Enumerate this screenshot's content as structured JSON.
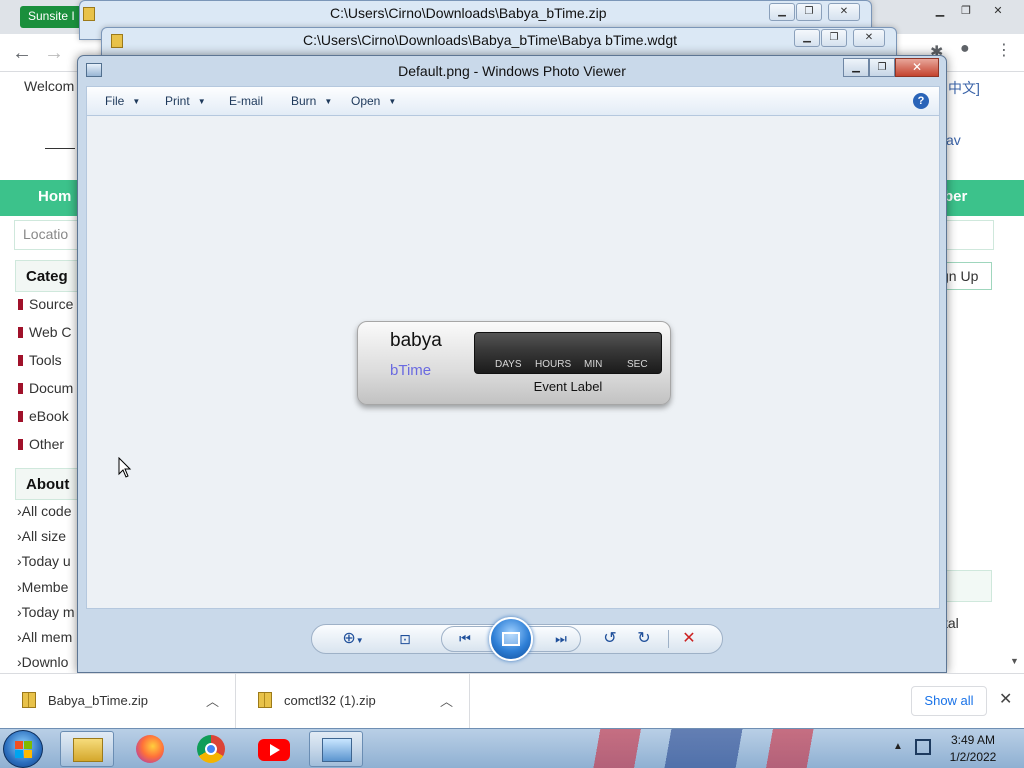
{
  "browser": {
    "tab_label": "Sunsite I",
    "welcome_text": "Welcom",
    "lang_link": "中文]",
    "right_link": "av",
    "location_placeholder": "Locatio",
    "nav_home": "Hom",
    "nav_right": "ber",
    "sign_up": "gn Up",
    "categories_heading": "Categ",
    "categories": [
      "Source",
      "Web C",
      "Tools",
      "Docum",
      "eBook",
      "Other"
    ],
    "about_heading": "About",
    "about_items": [
      "All code",
      "All size",
      "Today u",
      "Membe",
      "Today m",
      "All mem",
      "Downlo"
    ],
    "total_label": "tal"
  },
  "zip_window": {
    "title": "C:\\Users\\Cirno\\Downloads\\Babya_bTime.zip"
  },
  "wdgt_window": {
    "title": "C:\\Users\\Cirno\\Downloads\\Babya_bTime\\Babya bTime.wdgt"
  },
  "viewer": {
    "title": "Default.png - Windows Photo Viewer",
    "menu": {
      "file": "File",
      "print": "Print",
      "email": "E-mail",
      "burn": "Burn",
      "open": "Open"
    },
    "help_glyph": "?",
    "widget": {
      "name_line1": "babya",
      "name_line2": "bTime",
      "unit_days": "DAYS",
      "unit_hours": "HOURS",
      "unit_min": "MIN",
      "unit_sec": "SEC",
      "event_label": "Event Label"
    }
  },
  "downloads": {
    "items": [
      {
        "name": "Babya_bTime.zip"
      },
      {
        "name": "comctl32 (1).zip"
      }
    ],
    "show_all": "Show all"
  },
  "taskbar": {
    "time": "3:49 AM",
    "date": "1/2/2022"
  },
  "colors": {
    "site_green": "#3cc28b",
    "viewer_frame": "#c9d9ea",
    "widget_accent": "#6a6ae0",
    "delete_red": "#cc2222",
    "show_all_blue": "#1a73e8"
  }
}
